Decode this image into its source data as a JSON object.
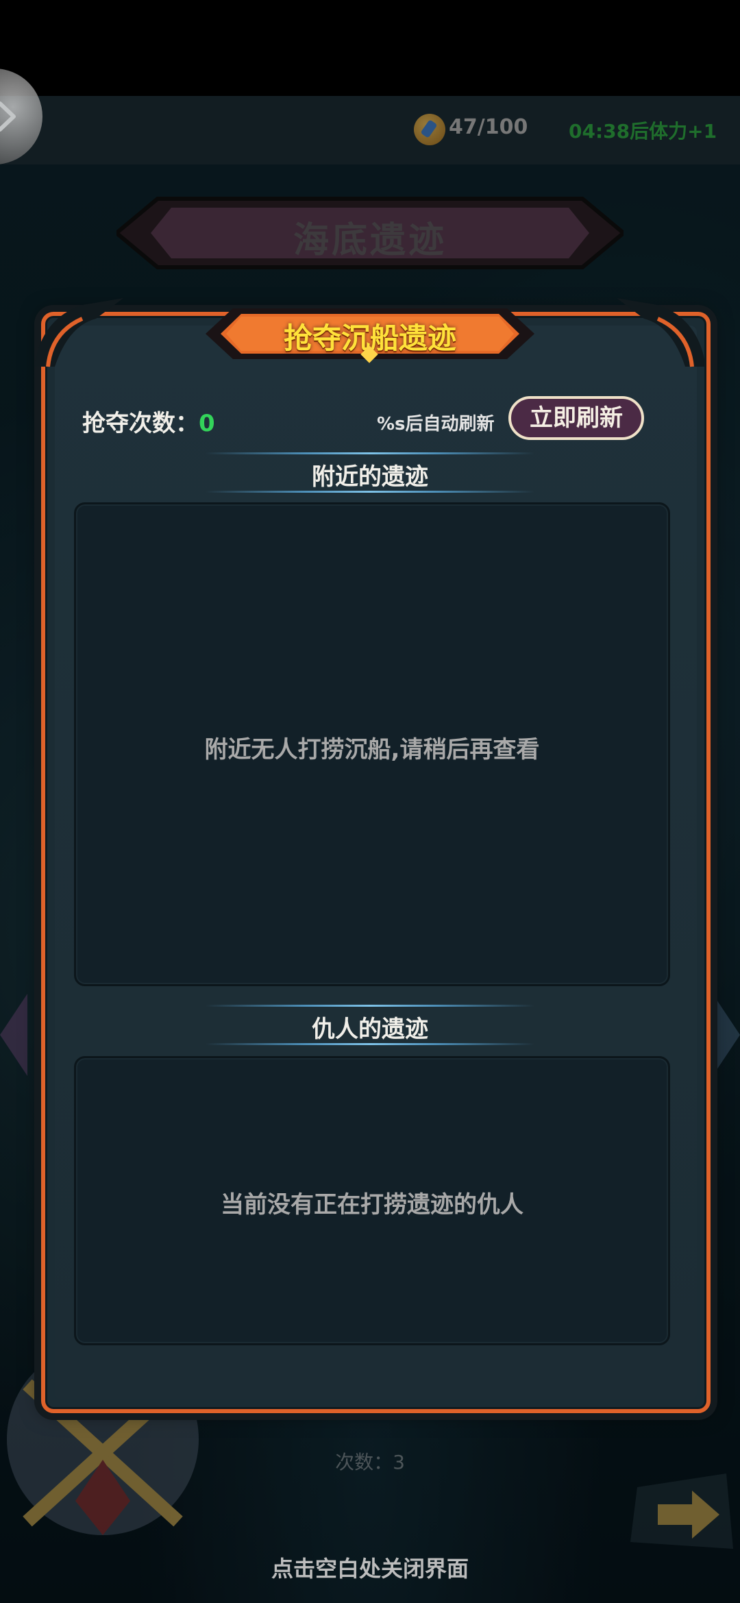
{
  "header": {
    "stamina_value": "47/100",
    "stamina_timer": "04:38后体力+1",
    "page_title": "海底遗迹"
  },
  "modal": {
    "title": "抢夺沉船遗迹",
    "rob_label": "抢夺次数：",
    "rob_count": "0",
    "auto_refresh_text": "%s后自动刷新",
    "refresh_button": "立即刷新",
    "nearby_heading": "附近的遗迹",
    "nearby_empty": "附近无人打捞沉船,请稍后再查看",
    "enemy_heading": "仇人的遗迹",
    "enemy_empty": "当前没有正在打捞遗迹的仇人"
  },
  "background": {
    "counter_text": "次数：3"
  },
  "footer": {
    "close_hint": "点击空白处关闭界面"
  },
  "colors": {
    "frame_orange": "#e0622a",
    "title_yellow": "#ffe23a",
    "count_green": "#33d45a",
    "refresh_button_bg": "#4b2a45"
  }
}
